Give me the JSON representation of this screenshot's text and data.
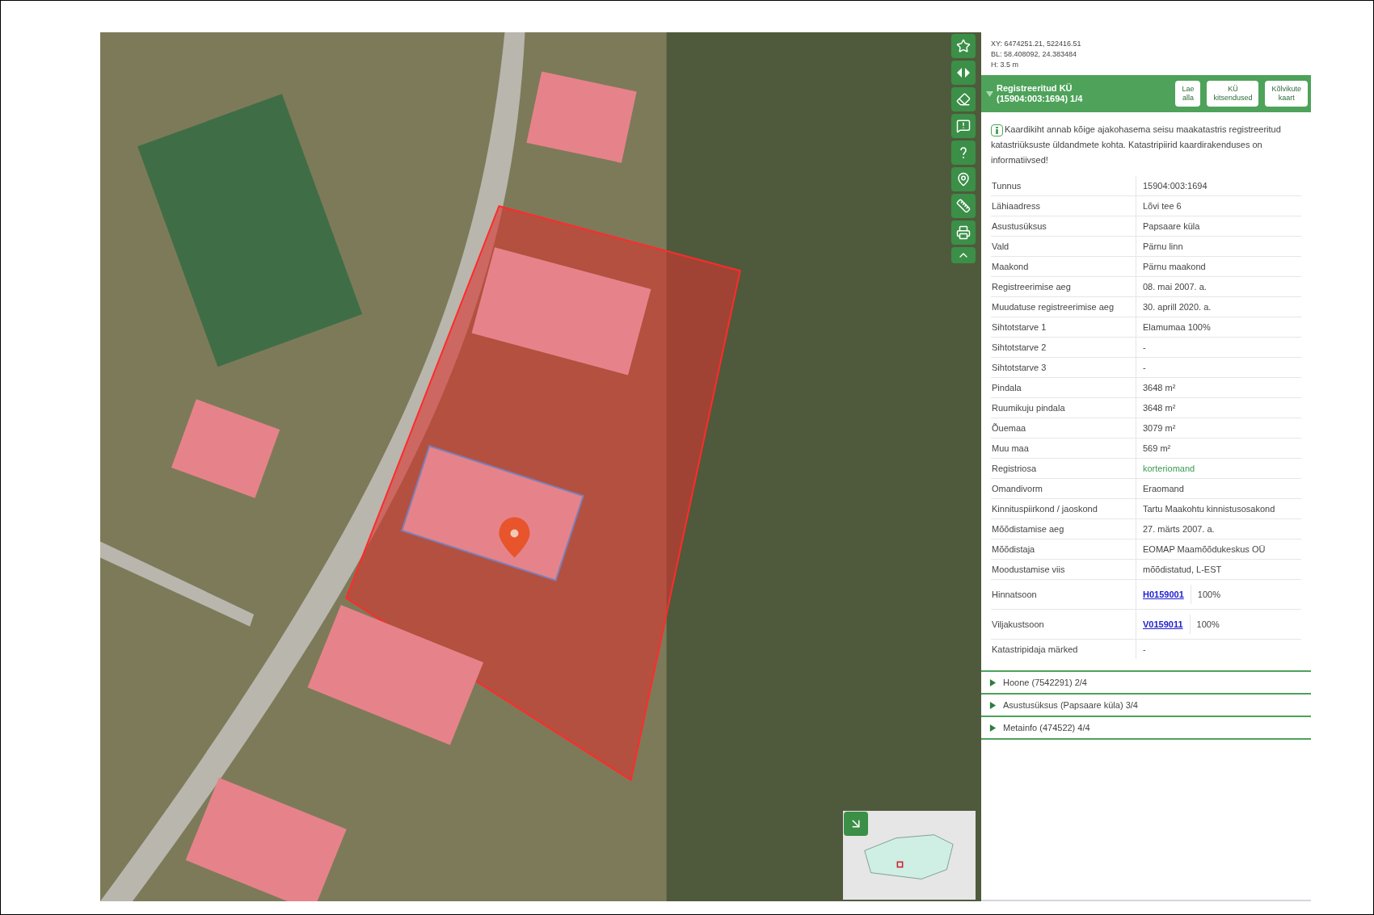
{
  "coordinates": [
    "XY: 6474251.21, 522416.51",
    "BL: 58.408092, 24.383484",
    "H: 3.5 m"
  ],
  "section": {
    "title_lines": [
      "Registreeritud KÜ",
      "(15904:003:1694) 1/4"
    ],
    "expanded": true,
    "buttons": [
      {
        "label_lines": [
          "Lae",
          "alla"
        ]
      },
      {
        "label_lines": [
          "KÜ",
          "kitsendused"
        ]
      },
      {
        "label_lines": [
          "Kõlvikute",
          "kaart"
        ]
      }
    ]
  },
  "info": "Kaardikiht annab kõige ajakohasema seisu maakatastris registreeritud katastriüksuste üldandmete kohta. Katastripiirid kaardirakenduses on informatiivsed!",
  "rows": [
    {
      "label": "Tunnus",
      "value": "15904:003:1694",
      "kind": "text"
    },
    {
      "label": "Lähiaadress",
      "value": "Lõvi tee 6",
      "kind": "text"
    },
    {
      "label": "Asustusüksus",
      "value": "Papsaare küla",
      "kind": "text"
    },
    {
      "label": "Vald",
      "value": "Pärnu linn",
      "kind": "text"
    },
    {
      "label": "Maakond",
      "value": "Pärnu maakond",
      "kind": "text"
    },
    {
      "label": "Registreerimise aeg",
      "value": "08. mai 2007. a.",
      "kind": "text"
    },
    {
      "label": "Muudatuse registreerimise aeg",
      "value": "30. aprill 2020. a.",
      "kind": "text"
    },
    {
      "label": "Sihtotstarve 1",
      "value": "Elamumaa 100%",
      "kind": "text"
    },
    {
      "label": "Sihtotstarve 2",
      "value": "-",
      "kind": "text"
    },
    {
      "label": "Sihtotstarve 3",
      "value": "-",
      "kind": "text"
    },
    {
      "label": "Pindala",
      "value": "3648 m²",
      "kind": "text"
    },
    {
      "label": "Ruumikuju pindala",
      "value": "3648 m²",
      "kind": "text"
    },
    {
      "label": "Õuemaa",
      "value": "3079 m²",
      "kind": "text"
    },
    {
      "label": "Muu maa",
      "value": "569 m²",
      "kind": "text"
    },
    {
      "label": "Registriosa",
      "value": "korteriomand",
      "kind": "register-link"
    },
    {
      "label": "Omandivorm",
      "value": "Eraomand",
      "kind": "text"
    },
    {
      "label": "Kinnituspiirkond / jaoskond",
      "value": "Tartu Maakohtu kinnistusosakond",
      "kind": "text"
    },
    {
      "label": "Mõõdistamise aeg",
      "value": "27. märts 2007. a.",
      "kind": "text"
    },
    {
      "label": "Mõõdistaja",
      "value": "EOMAP Maamõõdukeskus OÜ",
      "kind": "text"
    },
    {
      "label": "Moodustamise viis",
      "value": "mõõdistatud, L-EST",
      "kind": "text"
    },
    {
      "label": "Hinnatsoon",
      "value": "H0159001",
      "percent": "100%",
      "kind": "zone"
    },
    {
      "label": "Viljakustsoon",
      "value": "V0159011",
      "percent": "100%",
      "kind": "zone"
    },
    {
      "label": "Katastripidaja märked",
      "value": "-",
      "kind": "text"
    }
  ],
  "accordions": [
    {
      "title": "Hoone (7542291) 2/4",
      "expanded": false
    },
    {
      "title": "Asustusüksus (Papsaare küla) 3/4",
      "expanded": false
    },
    {
      "title": "Metainfo (474522) 4/4",
      "expanded": false
    }
  ]
}
